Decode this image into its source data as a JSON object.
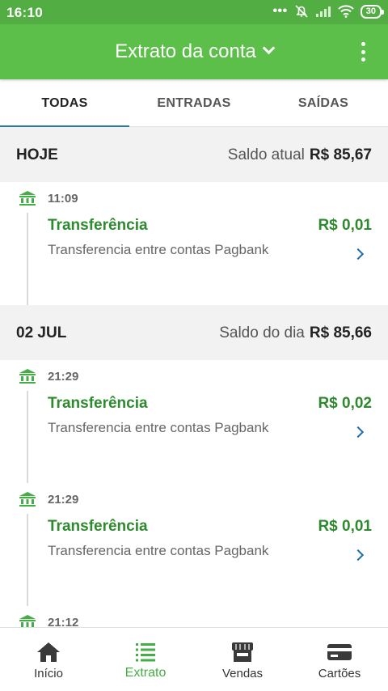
{
  "status": {
    "time": "16:10",
    "battery": "30",
    "icons": [
      "more-dots-icon",
      "mute-icon",
      "signal-icon",
      "wifi-icon",
      "battery-icon"
    ]
  },
  "header": {
    "title": "Extrato da conta",
    "menu_icon": "kebab-menu-icon"
  },
  "tabs": [
    {
      "label": "TODAS",
      "active": true
    },
    {
      "label": "ENTRADAS",
      "active": false
    },
    {
      "label": "SAÍDAS",
      "active": false
    }
  ],
  "sections": [
    {
      "label": "HOJE",
      "balance_label": "Saldo atual",
      "balance_value": "R$ 85,67",
      "transactions": [
        {
          "time": "11:09",
          "title": "Transferência",
          "amount": "R$ 0,01",
          "description": "Transferencia entre contas Pagbank"
        }
      ]
    },
    {
      "label": "02 JUL",
      "balance_label": "Saldo do dia",
      "balance_value": "R$ 85,66",
      "transactions": [
        {
          "time": "21:29",
          "title": "Transferência",
          "amount": "R$ 0,02",
          "description": "Transferencia entre contas Pagbank"
        },
        {
          "time": "21:29",
          "title": "Transferência",
          "amount": "R$ 0,01",
          "description": "Transferencia entre contas Pagbank"
        },
        {
          "time": "21:12"
        }
      ]
    }
  ],
  "bottom_nav": [
    {
      "label": "Início",
      "icon": "home-icon",
      "active": false
    },
    {
      "label": "Extrato",
      "icon": "list-icon",
      "active": true
    },
    {
      "label": "Vendas",
      "icon": "store-icon",
      "active": false
    },
    {
      "label": "Cartões",
      "icon": "card-icon",
      "active": false
    }
  ],
  "colors": {
    "primary_green": "#5cbf4a",
    "amount_green": "#2e8a2e",
    "tab_underline": "#2a7ba8",
    "arrow_blue": "#1b6fa8"
  }
}
